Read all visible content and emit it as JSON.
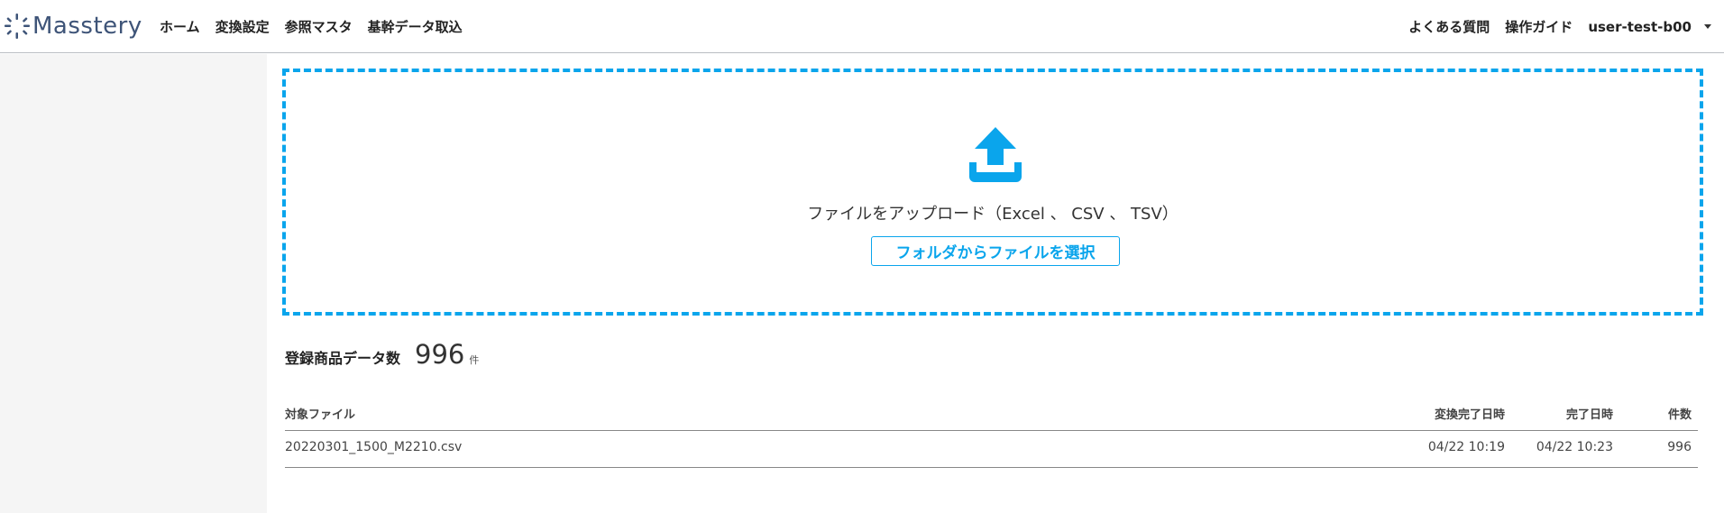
{
  "header": {
    "logo_text": "Masstery",
    "nav": [
      "ホーム",
      "変換設定",
      "参照マスタ",
      "基幹データ取込"
    ],
    "faq": "よくある質問",
    "guide": "操作ガイド",
    "user": "user-test-b00"
  },
  "upload": {
    "icon": "upload-icon",
    "text": "ファイルをアップロード（Excel 、 CSV 、 TSV）",
    "button_label": "フォルダからファイルを選択"
  },
  "summary": {
    "label": "登録商品データ数",
    "value": "996",
    "unit": "件"
  },
  "table": {
    "headers": {
      "file": "対象ファイル",
      "converted_at": "変換完了日時",
      "completed_at": "完了日時",
      "count": "件数"
    },
    "rows": [
      {
        "file": "20220301_1500_M2210.csv",
        "converted_at": "04/22 10:19",
        "completed_at": "04/22 10:23",
        "count": "996"
      }
    ]
  },
  "colors": {
    "accent": "#0aa5ec",
    "logo": "#3e5478",
    "sidebar_bg": "#f5f5f5"
  }
}
